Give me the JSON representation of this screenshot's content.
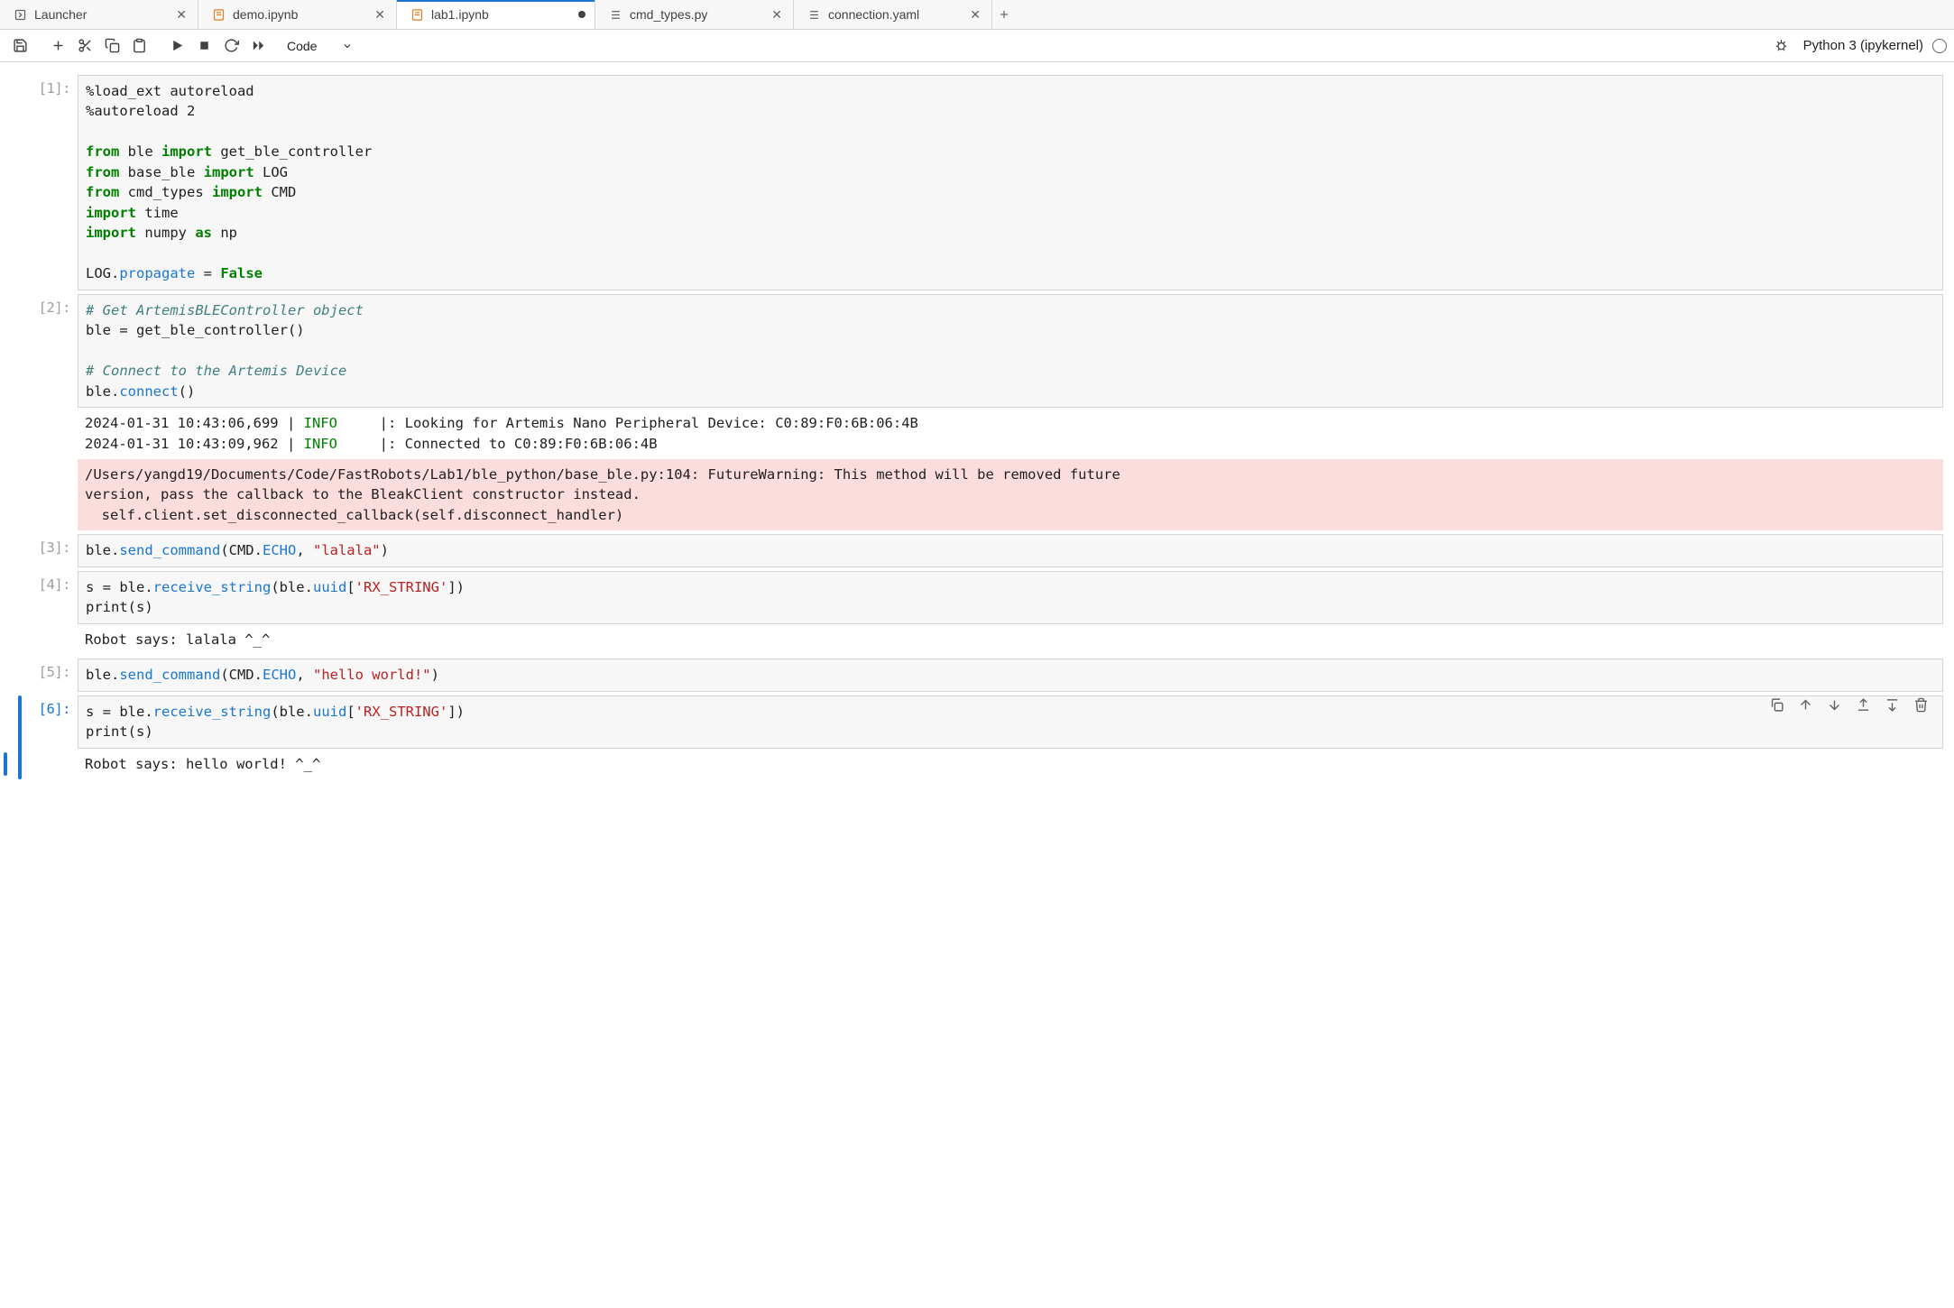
{
  "tabs": [
    {
      "label": "Launcher",
      "icon": "launcher",
      "closable": true
    },
    {
      "label": "demo.ipynb",
      "icon": "notebook",
      "closable": true
    },
    {
      "label": "lab1.ipynb",
      "icon": "notebook",
      "active": true,
      "dirty": true
    },
    {
      "label": "cmd_types.py",
      "icon": "python",
      "closable": true
    },
    {
      "label": "connection.yaml",
      "icon": "yaml",
      "closable": true
    }
  ],
  "toolbar": {
    "celltype": "Code",
    "kernel": "Python 3 (ipykernel)"
  },
  "cells": [
    {
      "prompt": "[1]:",
      "code_tokens": [
        [
          "txt",
          "%load_ext autoreload\n%autoreload 2\n\n"
        ],
        [
          "kw",
          "from"
        ],
        [
          "txt",
          " ble "
        ],
        [
          "kw",
          "import"
        ],
        [
          "txt",
          " get_ble_controller\n"
        ],
        [
          "kw",
          "from"
        ],
        [
          "txt",
          " base_ble "
        ],
        [
          "kw",
          "import"
        ],
        [
          "txt",
          " LOG\n"
        ],
        [
          "kw",
          "from"
        ],
        [
          "txt",
          " cmd_types "
        ],
        [
          "kw",
          "import"
        ],
        [
          "txt",
          " CMD\n"
        ],
        [
          "kw",
          "import"
        ],
        [
          "txt",
          " time\n"
        ],
        [
          "kw",
          "import"
        ],
        [
          "txt",
          " numpy "
        ],
        [
          "kw",
          "as"
        ],
        [
          "txt",
          " np\n\nLOG."
        ],
        [
          "attr",
          "propagate"
        ],
        [
          "txt",
          " = "
        ],
        [
          "num",
          "False"
        ]
      ]
    },
    {
      "prompt": "[2]:",
      "code_tokens": [
        [
          "cmt",
          "# Get ArtemisBLEController object"
        ],
        [
          "txt",
          "\nble = get_ble_controller()\n\n"
        ],
        [
          "cmt",
          "# Connect to the Artemis Device"
        ],
        [
          "txt",
          "\nble."
        ],
        [
          "attr",
          "connect"
        ],
        [
          "txt",
          "()"
        ]
      ],
      "outputs": [
        {
          "type": "log",
          "tokens": [
            [
              "txt",
              "2024-01-31 10:43:06,699 | "
            ],
            [
              "info",
              "INFO"
            ],
            [
              "txt",
              "     |: Looking for Artemis Nano Peripheral Device: C0:89:F0:6B:06:4B\n2024-01-31 10:43:09,962 | "
            ],
            [
              "info",
              "INFO"
            ],
            [
              "txt",
              "     |: Connected to C0:89:F0:6B:06:4B"
            ]
          ]
        },
        {
          "type": "warning",
          "text": "/Users/yangd19/Documents/Code/FastRobots/Lab1/ble_python/base_ble.py:104: FutureWarning: This method will be removed future\nversion, pass the callback to the BleakClient constructor instead.\n  self.client.set_disconnected_callback(self.disconnect_handler)"
        }
      ]
    },
    {
      "prompt": "[3]:",
      "code_tokens": [
        [
          "txt",
          "ble."
        ],
        [
          "attr",
          "send_command"
        ],
        [
          "txt",
          "(CMD."
        ],
        [
          "attr",
          "ECHO"
        ],
        [
          "txt",
          ", "
        ],
        [
          "str",
          "\"lalala\""
        ],
        [
          "txt",
          ")"
        ]
      ]
    },
    {
      "prompt": "[4]:",
      "code_tokens": [
        [
          "txt",
          "s = ble."
        ],
        [
          "attr",
          "receive_string"
        ],
        [
          "txt",
          "(ble."
        ],
        [
          "attr",
          "uuid"
        ],
        [
          "txt",
          "["
        ],
        [
          "str",
          "'RX_STRING'"
        ],
        [
          "txt",
          "])\nprint(s)"
        ]
      ],
      "outputs": [
        {
          "type": "plain",
          "text": "Robot says: lalala ^_^"
        }
      ]
    },
    {
      "prompt": "[5]:",
      "code_tokens": [
        [
          "txt",
          "ble."
        ],
        [
          "attr",
          "send_command"
        ],
        [
          "txt",
          "(CMD."
        ],
        [
          "attr",
          "ECHO"
        ],
        [
          "txt",
          ", "
        ],
        [
          "str",
          "\"hello world!\""
        ],
        [
          "txt",
          ")"
        ]
      ]
    },
    {
      "prompt": "[6]:",
      "selected": true,
      "code_tokens": [
        [
          "txt",
          "s = ble."
        ],
        [
          "attr",
          "receive_string"
        ],
        [
          "txt",
          "(ble."
        ],
        [
          "attr",
          "uuid"
        ],
        [
          "txt",
          "["
        ],
        [
          "str",
          "'RX_STRING'"
        ],
        [
          "txt",
          "])\nprint(s)"
        ]
      ],
      "outputs": [
        {
          "type": "plain",
          "text": "Robot says: hello world! ^_^"
        }
      ]
    }
  ]
}
